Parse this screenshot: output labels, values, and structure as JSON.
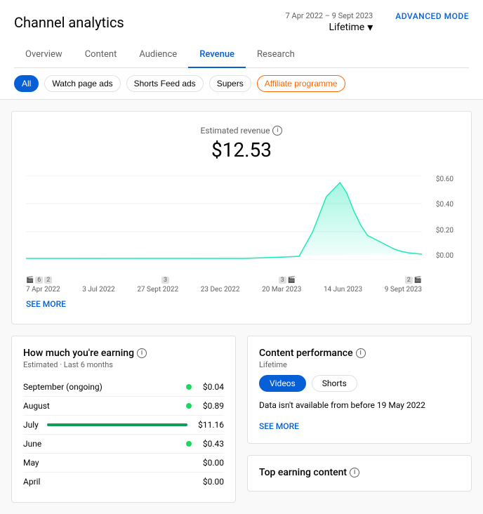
{
  "header": {
    "title": "Channel analytics",
    "advanced_mode": "ADVANCED MODE"
  },
  "nav": {
    "tabs": [
      {
        "label": "Overview",
        "active": false
      },
      {
        "label": "Content",
        "active": false
      },
      {
        "label": "Audience",
        "active": false
      },
      {
        "label": "Revenue",
        "active": true
      },
      {
        "label": "Research",
        "active": false
      }
    ]
  },
  "date_range": {
    "label": "7 Apr 2022 – 9 Sept 2023",
    "value": "Lifetime"
  },
  "filters": [
    {
      "label": "All",
      "active": true,
      "style": "normal"
    },
    {
      "label": "Watch page ads",
      "active": false,
      "style": "normal"
    },
    {
      "label": "Shorts Feed ads",
      "active": false,
      "style": "normal"
    },
    {
      "label": "Supers",
      "active": false,
      "style": "normal"
    },
    {
      "label": "Affiliate programme",
      "active": false,
      "style": "orange"
    }
  ],
  "chart": {
    "revenue_label": "Estimated revenue",
    "revenue_amount": "$12.53",
    "y_axis": [
      "$0.60",
      "$0.40",
      "$0.20",
      "$0.00"
    ],
    "x_dates": [
      "7 Apr 2022",
      "3 Jul 2022",
      "27 Sept 2022",
      "23 Dec 2022",
      "20 Mar 2023",
      "14 Jun 2023",
      "9 Sept 2023"
    ],
    "see_more": "SEE MORE"
  },
  "earnings": {
    "title": "How much you're earning",
    "subtitle": "Estimated · Last 6 months",
    "rows": [
      {
        "month": "September (ongoing)",
        "amount": "$0.04",
        "bar_pct": 0,
        "dot": true
      },
      {
        "month": "August",
        "amount": "$0.89",
        "bar_pct": 8,
        "dot": true
      },
      {
        "month": "July",
        "amount": "$11.16",
        "bar_pct": 100,
        "dot": false,
        "big_bar": true
      },
      {
        "month": "June",
        "amount": "$0.43",
        "bar_pct": 4,
        "dot": true
      },
      {
        "month": "May",
        "amount": "$0.00",
        "bar_pct": 0,
        "dot": false,
        "no_dot": true
      },
      {
        "month": "April",
        "amount": "$0.00",
        "bar_pct": 0,
        "dot": false,
        "no_dot": true
      }
    ]
  },
  "content_performance": {
    "title": "Content performance",
    "subtitle": "Lifetime",
    "tabs": [
      "Videos",
      "Shorts"
    ],
    "no_data": "Data isn't available from before 19 May 2022",
    "see_more": "SEE MORE"
  },
  "top_earning": {
    "title": "Top earning content"
  }
}
